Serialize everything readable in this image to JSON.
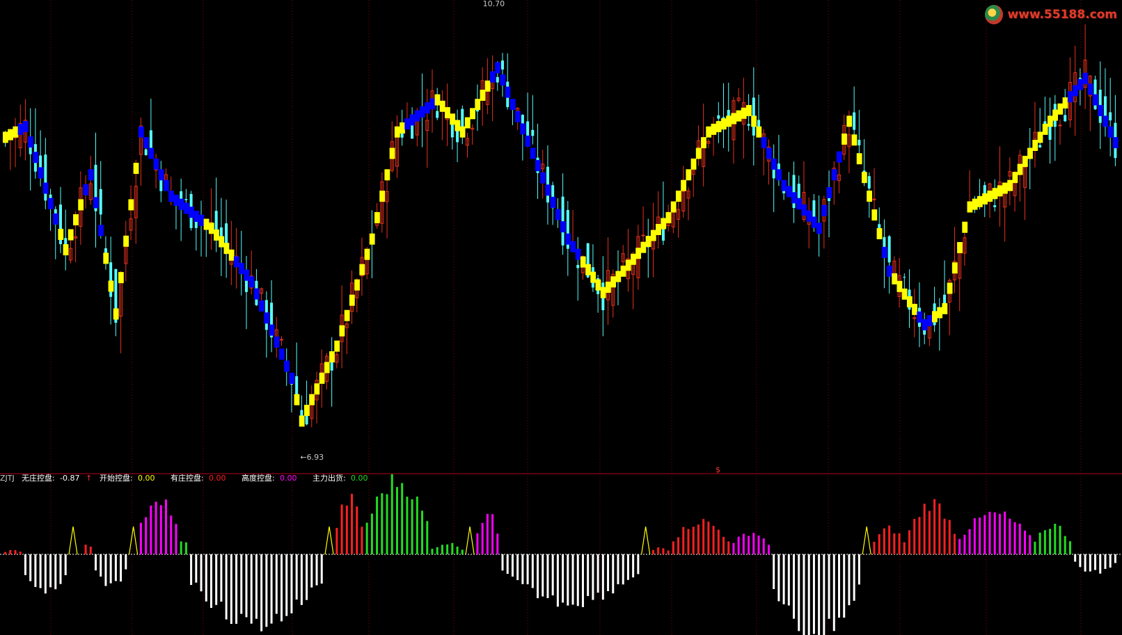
{
  "watermark": {
    "text": "www.55188.com",
    "logo_icon": "55188-logo-icon"
  },
  "colors": {
    "background": "#000000",
    "candle_up": "#e8301c",
    "candle_down": "#54ffff",
    "trend_up": "#ffff00",
    "trend_down": "#0000ff",
    "grid": "#8b0000",
    "separator": "#b3001b",
    "hist_white": "#ffffff",
    "hist_red": "#ff2020",
    "hist_green": "#22dd22",
    "hist_magenta": "#ff00ff",
    "marker_yellow": "#ffff00"
  },
  "price_panel": {
    "high_label": "10.70",
    "low_label": "←6.93",
    "high_value": 10.7,
    "low_value": 6.93
  },
  "indicator": {
    "name": "ZJTJ",
    "separator_mark": "$",
    "legend": [
      {
        "label": "无庄控盘:",
        "value": "-0.87",
        "arrow": "↑",
        "color": "#ffffff"
      },
      {
        "label": "开始控盘:",
        "value": "0.00",
        "color": "#ffff00"
      },
      {
        "label": "有庄控盘:",
        "value": "0.00",
        "color": "#ff2020"
      },
      {
        "label": "高度控盘:",
        "value": "0.00",
        "color": "#ff00ff"
      },
      {
        "label": "主力出货:",
        "value": "0.00",
        "color": "#22dd22"
      }
    ]
  },
  "chart_data": {
    "type": "candlestick",
    "bars": 222,
    "price_path": [
      [
        0,
        9.75
      ],
      [
        4,
        9.85
      ],
      [
        12,
        8.7
      ],
      [
        17,
        9.4
      ],
      [
        22,
        8.1
      ],
      [
        27,
        9.8
      ],
      [
        33,
        9.2
      ],
      [
        41,
        8.9
      ],
      [
        49,
        8.4
      ],
      [
        57,
        7.5
      ],
      [
        59,
        7.1
      ],
      [
        66,
        7.8
      ],
      [
        73,
        8.8
      ],
      [
        78,
        9.8
      ],
      [
        86,
        10.1
      ],
      [
        91,
        9.8
      ],
      [
        98,
        10.4
      ],
      [
        105,
        9.6
      ],
      [
        112,
        8.8
      ],
      [
        119,
        8.3
      ],
      [
        123,
        8.5
      ],
      [
        132,
        9.0
      ],
      [
        140,
        9.8
      ],
      [
        148,
        10.0
      ],
      [
        155,
        9.3
      ],
      [
        162,
        8.9
      ],
      [
        168,
        9.9
      ],
      [
        176,
        8.5
      ],
      [
        183,
        8.0
      ],
      [
        187,
        8.15
      ],
      [
        192,
        9.1
      ],
      [
        200,
        9.3
      ],
      [
        208,
        9.9
      ],
      [
        215,
        10.3
      ],
      [
        219,
        9.9
      ],
      [
        221,
        9.7
      ]
    ],
    "trend_colors": [
      [
        0,
        "up"
      ],
      [
        3,
        "down"
      ],
      [
        11,
        "up"
      ],
      [
        16,
        "down"
      ],
      [
        20,
        "up"
      ],
      [
        27,
        "down"
      ],
      [
        35,
        "down"
      ],
      [
        40,
        "up"
      ],
      [
        46,
        "down"
      ],
      [
        58,
        "up"
      ],
      [
        80,
        "down"
      ],
      [
        86,
        "up"
      ],
      [
        97,
        "down"
      ],
      [
        100,
        "down"
      ],
      [
        108,
        "down"
      ],
      [
        115,
        "up"
      ],
      [
        121,
        "up"
      ],
      [
        139,
        "up"
      ],
      [
        148,
        "up"
      ],
      [
        151,
        "down"
      ],
      [
        163,
        "down"
      ],
      [
        167,
        "up"
      ],
      [
        175,
        "down"
      ],
      [
        177,
        "up"
      ],
      [
        182,
        "down"
      ],
      [
        185,
        "up"
      ],
      [
        205,
        "up"
      ],
      [
        210,
        "up"
      ],
      [
        212,
        "down"
      ]
    ],
    "histogram_segments": [
      [
        0,
        4,
        "red",
        0.06
      ],
      [
        4,
        13,
        "white",
        -0.55
      ],
      [
        13,
        16,
        "marker",
        0.5
      ],
      [
        16,
        18,
        "red",
        0.15
      ],
      [
        18,
        25,
        "white",
        -0.45
      ],
      [
        25,
        27,
        "marker",
        0.5
      ],
      [
        27,
        35,
        "magenta",
        0.8
      ],
      [
        35,
        37,
        "green",
        0.2
      ],
      [
        37,
        64,
        "white",
        -0.95
      ],
      [
        64,
        66,
        "marker",
        0.5
      ],
      [
        66,
        72,
        "red",
        0.75
      ],
      [
        72,
        85,
        "green",
        1.0
      ],
      [
        85,
        92,
        "green",
        0.15
      ],
      [
        92,
        94,
        "marker",
        0.5
      ],
      [
        94,
        99,
        "magenta",
        0.55
      ],
      [
        99,
        127,
        "white",
        -0.65
      ],
      [
        127,
        129,
        "marker",
        0.5
      ],
      [
        129,
        133,
        "red",
        0.1
      ],
      [
        133,
        145,
        "red",
        0.45
      ],
      [
        145,
        153,
        "magenta",
        0.3
      ],
      [
        153,
        171,
        "white",
        -1.1
      ],
      [
        171,
        173,
        "marker",
        0.5
      ],
      [
        173,
        180,
        "red",
        0.35
      ],
      [
        180,
        190,
        "red",
        0.7
      ],
      [
        190,
        205,
        "magenta",
        0.55
      ],
      [
        205,
        213,
        "green",
        0.4
      ],
      [
        213,
        222,
        "white",
        -0.25
      ]
    ],
    "price_range": [
      6.7,
      11.0
    ],
    "grid": true
  }
}
